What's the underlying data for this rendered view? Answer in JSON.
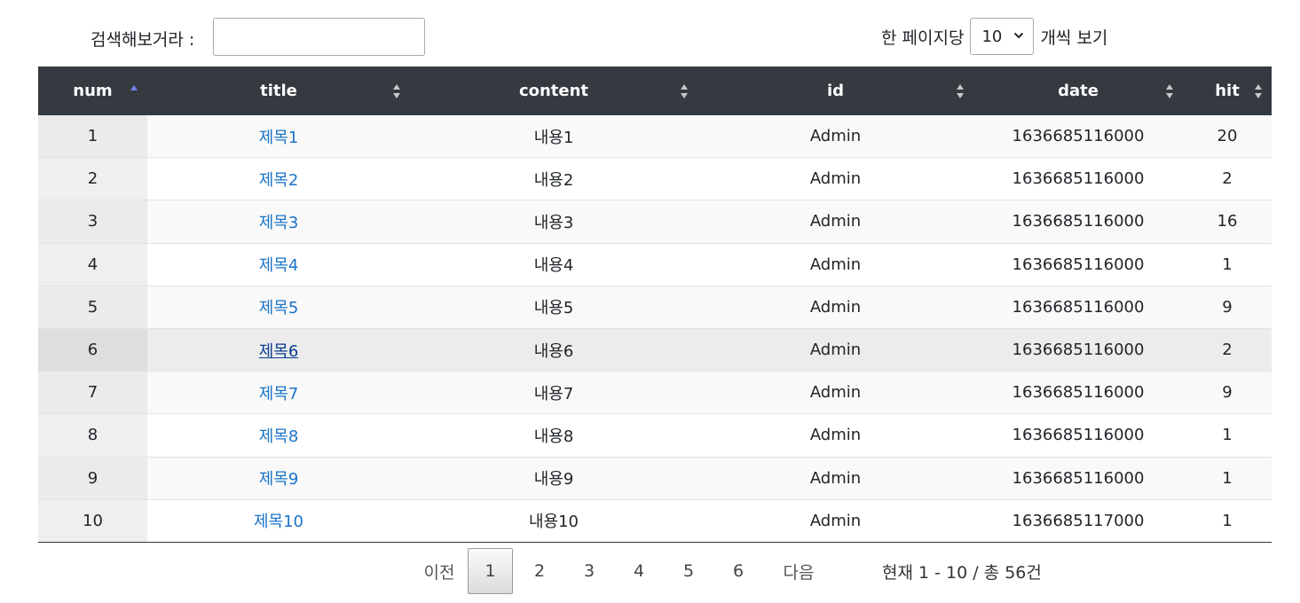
{
  "search": {
    "label": "검색해보거라 :",
    "value": "",
    "placeholder": ""
  },
  "length": {
    "prefix": "한 페이지당",
    "selected": "10",
    "suffix": "개씩 보기",
    "options": [
      "10"
    ]
  },
  "columns": [
    {
      "label": "num",
      "sort": "asc"
    },
    {
      "label": "title",
      "sort": "both"
    },
    {
      "label": "content",
      "sort": "both"
    },
    {
      "label": "id",
      "sort": "both"
    },
    {
      "label": "date",
      "sort": "both"
    },
    {
      "label": "hit",
      "sort": "both"
    }
  ],
  "rows": [
    {
      "num": "1",
      "title": "제목1",
      "content": "내용1",
      "id": "Admin",
      "date": "1636685116000",
      "hit": "20"
    },
    {
      "num": "2",
      "title": "제목2",
      "content": "내용2",
      "id": "Admin",
      "date": "1636685116000",
      "hit": "2"
    },
    {
      "num": "3",
      "title": "제목3",
      "content": "내용3",
      "id": "Admin",
      "date": "1636685116000",
      "hit": "16"
    },
    {
      "num": "4",
      "title": "제목4",
      "content": "내용4",
      "id": "Admin",
      "date": "1636685116000",
      "hit": "1"
    },
    {
      "num": "5",
      "title": "제목5",
      "content": "내용5",
      "id": "Admin",
      "date": "1636685116000",
      "hit": "9"
    },
    {
      "num": "6",
      "title": "제목6",
      "content": "내용6",
      "id": "Admin",
      "date": "1636685116000",
      "hit": "2"
    },
    {
      "num": "7",
      "title": "제목7",
      "content": "내용7",
      "id": "Admin",
      "date": "1636685116000",
      "hit": "9"
    },
    {
      "num": "8",
      "title": "제목8",
      "content": "내용8",
      "id": "Admin",
      "date": "1636685116000",
      "hit": "1"
    },
    {
      "num": "9",
      "title": "제목9",
      "content": "내용9",
      "id": "Admin",
      "date": "1636685116000",
      "hit": "1"
    },
    {
      "num": "10",
      "title": "제목10",
      "content": "내용10",
      "id": "Admin",
      "date": "1636685117000",
      "hit": "1"
    }
  ],
  "hover_row": "6",
  "pagination": {
    "prev": "이전",
    "pages": [
      "1",
      "2",
      "3",
      "4",
      "5",
      "6"
    ],
    "current": "1",
    "next": "다음"
  },
  "info": "현재 1 - 10 / 총 56건",
  "colors": {
    "header_bg": "#343a40",
    "link": "#1a73c9",
    "sort_active": "#6f7fe8"
  }
}
